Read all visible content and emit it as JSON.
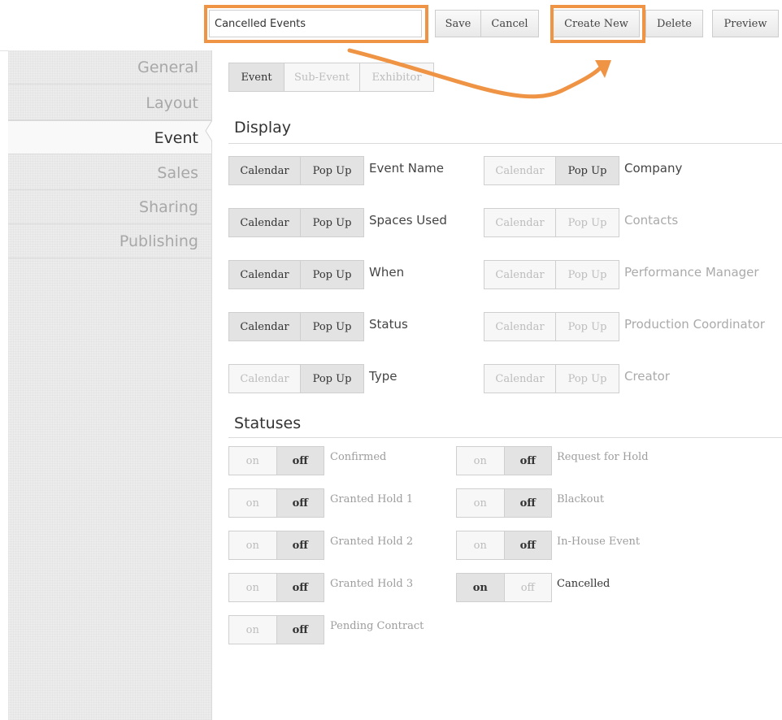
{
  "toolbar": {
    "name_value": "Cancelled Events",
    "save_label": "Save",
    "cancel_label": "Cancel",
    "create_new_label": "Create New",
    "delete_label": "Delete",
    "preview_label": "Preview"
  },
  "sidebar": {
    "items": [
      {
        "label": "General",
        "active": false
      },
      {
        "label": "Layout",
        "active": false
      },
      {
        "label": "Event",
        "active": true
      },
      {
        "label": "Sales",
        "active": false
      },
      {
        "label": "Sharing",
        "active": false
      },
      {
        "label": "Publishing",
        "active": false
      }
    ]
  },
  "tabs": [
    {
      "label": "Event",
      "active": true
    },
    {
      "label": "Sub-Event",
      "active": false
    },
    {
      "label": "Exhibitor",
      "active": false
    }
  ],
  "display": {
    "title": "Display",
    "calendar_label": "Calendar",
    "popup_label": "Pop Up",
    "left": [
      {
        "label": "Event Name",
        "calendar": true,
        "popup": true
      },
      {
        "label": "Spaces Used",
        "calendar": true,
        "popup": true
      },
      {
        "label": "When",
        "calendar": true,
        "popup": true
      },
      {
        "label": "Status",
        "calendar": true,
        "popup": true
      },
      {
        "label": "Type",
        "calendar": false,
        "popup": true
      }
    ],
    "right": [
      {
        "label": "Company",
        "calendar": false,
        "popup": true
      },
      {
        "label": "Contacts",
        "calendar": false,
        "popup": false
      },
      {
        "label": "Performance Manager",
        "calendar": false,
        "popup": false
      },
      {
        "label": "Production Coordinator",
        "calendar": false,
        "popup": false
      },
      {
        "label": "Creator",
        "calendar": false,
        "popup": false
      }
    ]
  },
  "statuses": {
    "title": "Statuses",
    "on_label": "on",
    "off_label": "off",
    "left": [
      {
        "label": "Confirmed",
        "on": false
      },
      {
        "label": "Granted Hold 1",
        "on": false
      },
      {
        "label": "Granted Hold 2",
        "on": false
      },
      {
        "label": "Granted Hold 3",
        "on": false
      },
      {
        "label": "Pending Contract",
        "on": false
      }
    ],
    "right": [
      {
        "label": "Request for Hold",
        "on": false
      },
      {
        "label": "Blackout",
        "on": false
      },
      {
        "label": "In-House Event",
        "on": false
      },
      {
        "label": "Cancelled",
        "on": true
      }
    ]
  },
  "colors": {
    "highlight": "#ef9444",
    "selected_bg": "#e3e3e3",
    "unselected_bg": "#f7f7f7"
  }
}
